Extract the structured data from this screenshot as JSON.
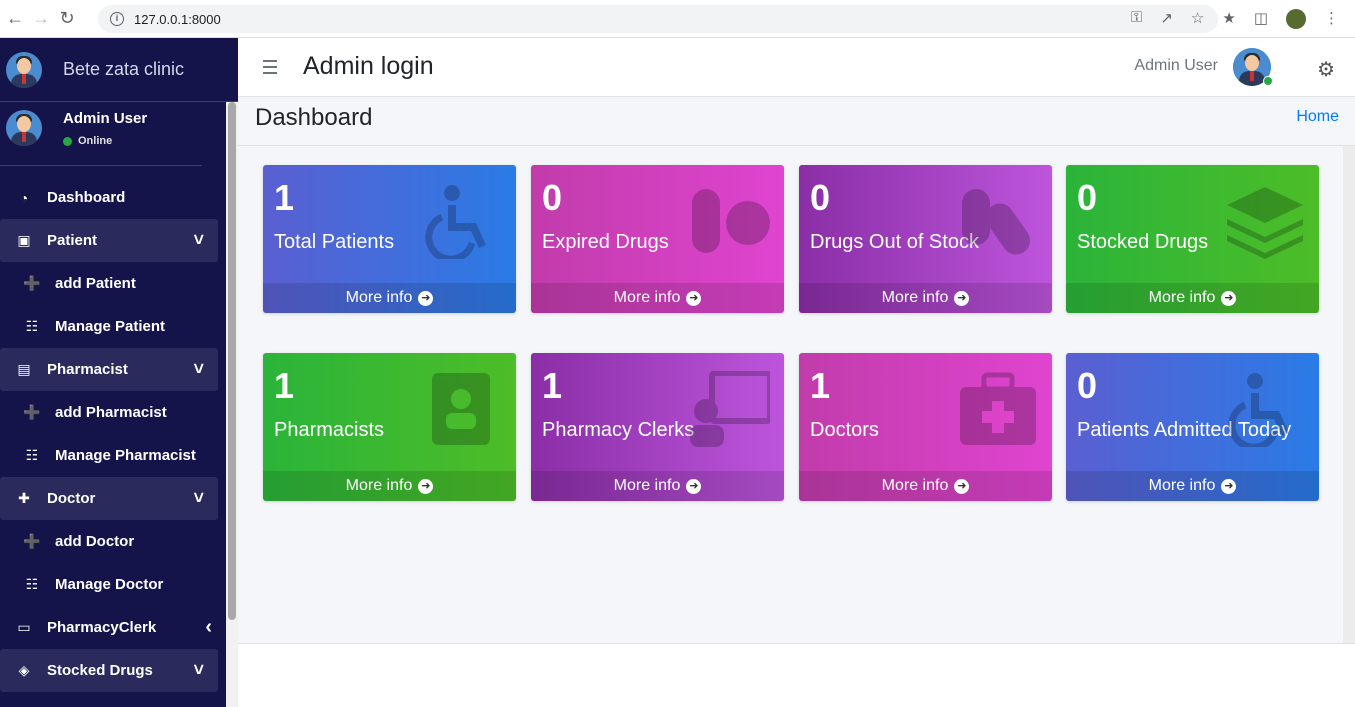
{
  "browser": {
    "url": "127.0.0.1:8000"
  },
  "sidebar": {
    "brand": "Bete zata clinic",
    "user": {
      "name": "Admin User",
      "status": "Online"
    },
    "items": [
      {
        "label": "Dashboard",
        "icon": "tachometer-icon",
        "kind": "item"
      },
      {
        "label": "Patient",
        "icon": "hospital-user-icon",
        "kind": "group",
        "caret": "down"
      },
      {
        "label": "add Patient",
        "icon": "user-plus-icon",
        "kind": "sub"
      },
      {
        "label": "Manage Patient",
        "icon": "grid-icon",
        "kind": "sub"
      },
      {
        "label": "Pharmacist",
        "icon": "id-badge-icon",
        "kind": "group",
        "caret": "down"
      },
      {
        "label": "add Pharmacist",
        "icon": "user-plus-icon",
        "kind": "sub"
      },
      {
        "label": "Manage Pharmacist",
        "icon": "grid-icon",
        "kind": "sub"
      },
      {
        "label": "Doctor",
        "icon": "medkit-icon",
        "kind": "group",
        "caret": "down"
      },
      {
        "label": "add Doctor",
        "icon": "user-plus-icon",
        "kind": "sub"
      },
      {
        "label": "Manage Doctor",
        "icon": "grid-icon",
        "kind": "sub"
      },
      {
        "label": "PharmacyClerk",
        "icon": "chalkboard-teacher-icon",
        "kind": "item",
        "caret": "left"
      },
      {
        "label": "Stocked Drugs",
        "icon": "layers-icon",
        "kind": "group",
        "caret": "down"
      }
    ]
  },
  "header": {
    "title": "Admin login",
    "user": "Admin User"
  },
  "content": {
    "page_title": "Dashboard",
    "breadcrumb": "Home"
  },
  "cards": [
    {
      "count": "1",
      "label": "Total Patients",
      "link": "More info",
      "color": "blue",
      "icon": "wheelchair-icon"
    },
    {
      "count": "0",
      "label": "Expired Drugs",
      "link": "More info",
      "color": "pink",
      "icon": "pills-icon"
    },
    {
      "count": "0",
      "label": "Drugs Out of Stock",
      "link": "More info",
      "color": "purple",
      "icon": "capsules-icon"
    },
    {
      "count": "0",
      "label": "Stocked Drugs",
      "link": "More info",
      "color": "green",
      "icon": "layers-icon"
    },
    {
      "count": "1",
      "label": "Pharmacists",
      "link": "More info",
      "color": "green",
      "icon": "address-book-icon"
    },
    {
      "count": "1",
      "label": "Pharmacy Clerks",
      "link": "More info",
      "color": "purple",
      "icon": "chalkboard-teacher-icon"
    },
    {
      "count": "1",
      "label": "Doctors",
      "link": "More info",
      "color": "pink",
      "icon": "medkit-icon"
    },
    {
      "count": "0",
      "label": "Patients Admitted Today",
      "link": "More info",
      "color": "blue",
      "icon": "wheelchair-icon"
    }
  ],
  "colors": {
    "sidebar_bg": "#14144a",
    "link": "#007bff",
    "online": "#28a745"
  }
}
